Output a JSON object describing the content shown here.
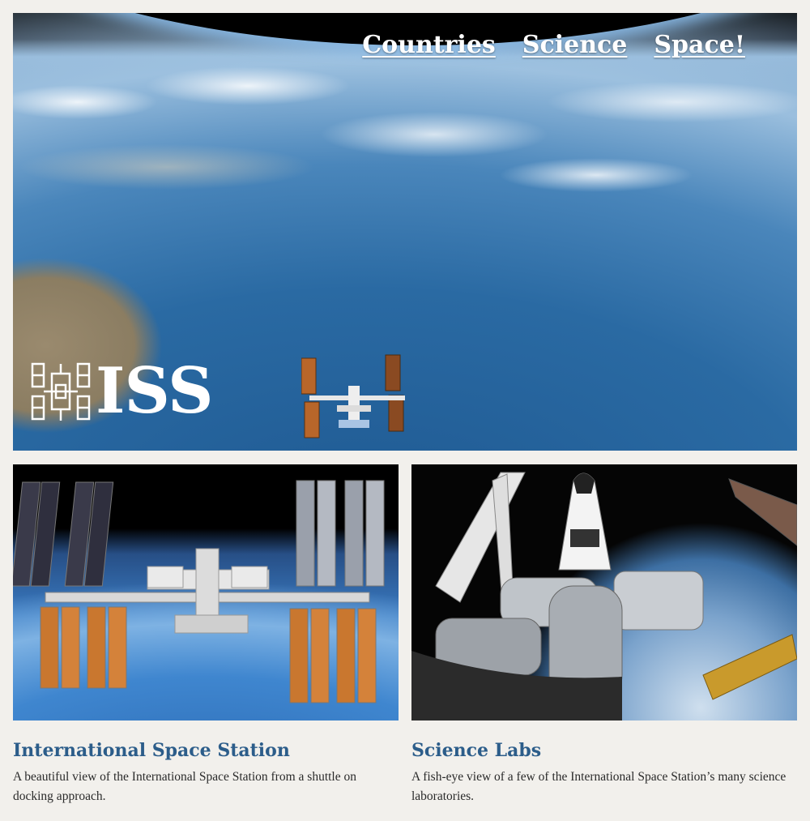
{
  "nav": {
    "items": [
      {
        "label": "Countries"
      },
      {
        "label": "Science"
      },
      {
        "label": "Space!"
      }
    ]
  },
  "logo": {
    "text": "ISS"
  },
  "cards": [
    {
      "title": "International Space Station",
      "description": "A beautiful view of the International Space Station from a shuttle on docking approach."
    },
    {
      "title": "Science Labs",
      "description": "A fish-eye view of a few of the International Space Station’s many science laboratories."
    }
  ],
  "colors": {
    "page_background": "#f2f0ec",
    "heading": "#2c5d8a",
    "nav_text": "#ffffff"
  }
}
